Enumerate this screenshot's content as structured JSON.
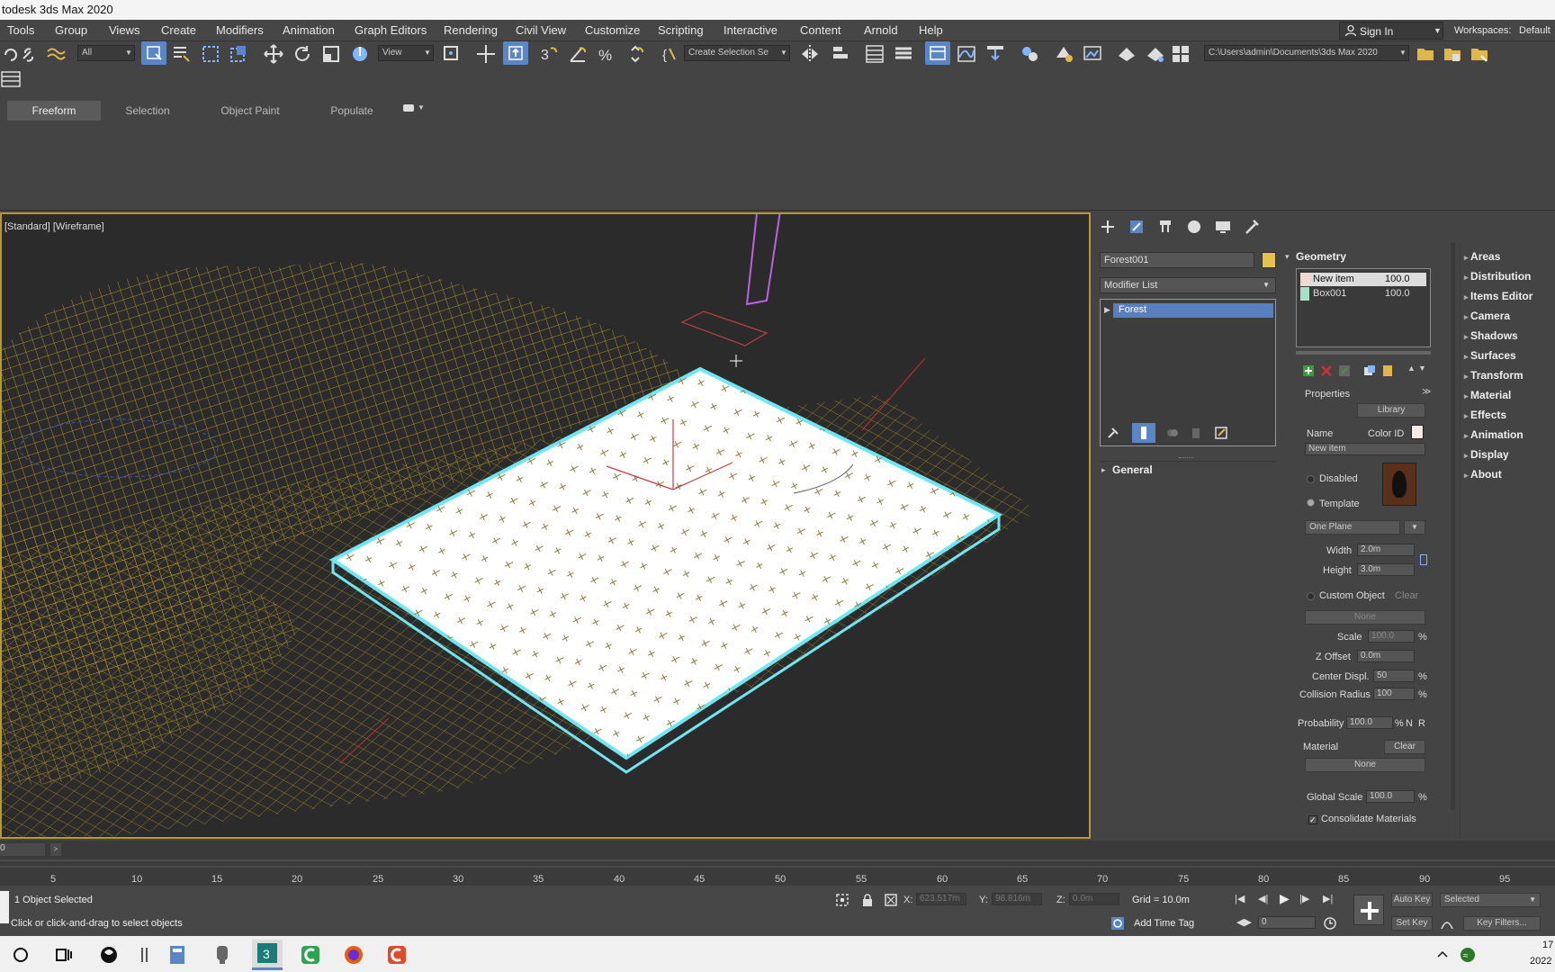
{
  "window": {
    "title": "todesk 3ds Max 2020"
  },
  "menu": {
    "items": [
      "Tools",
      "Group",
      "Views",
      "Create",
      "Modifiers",
      "Animation",
      "Graph Editors",
      "Rendering",
      "Civil View",
      "Customize",
      "Scripting",
      "Interactive",
      "Content",
      "Arnold",
      "Help"
    ],
    "sign_in": "Sign In",
    "workspaces_label": "Workspaces:",
    "workspaces_value": "Default"
  },
  "toolbar": {
    "filter_value": "All",
    "ref_coord_value": "View",
    "selection_set_value": "Create Selection Se",
    "project_path": "C:\\Users\\admin\\Documents\\3ds Max 2020"
  },
  "ribbon": {
    "tabs": [
      "Freeform",
      "Selection",
      "Object Paint",
      "Populate"
    ],
    "active_tab": "Freeform"
  },
  "viewport": {
    "label": "[Standard] [Wireframe]"
  },
  "command_panel": {
    "object_name": "Forest001",
    "object_color": "#e6c24d",
    "modifier_list": "Modifier List",
    "stack": [
      "Forest"
    ],
    "general_title": "General"
  },
  "geometry": {
    "title": "Geometry",
    "items": [
      {
        "name": "New item",
        "value": "100.0",
        "swatch": "#f2d9cf"
      },
      {
        "name": "Box001",
        "value": "100.0",
        "swatch": "#a6e0c8"
      }
    ],
    "properties_title": "Properties",
    "library_button": "Library",
    "name_label": "Name",
    "color_id_label": "Color ID",
    "name_value": "New item",
    "disabled_label": "Disabled",
    "template_label": "Template",
    "plane_value": "One Plane",
    "width_label": "Width",
    "width_value": "2.0m",
    "height_label": "Height",
    "height_value": "3.0m",
    "custom_object_label": "Custom Object",
    "clear_label": "Clear",
    "none_label": "None",
    "scale_label": "Scale",
    "scale_value": "100.0",
    "percent": "%",
    "z_offset_label": "Z Offset",
    "z_offset_value": "0.0m",
    "center_displ_label": "Center Displ.",
    "center_displ_value": "50",
    "collision_radius_label": "Collision Radius",
    "collision_radius_value": "100",
    "probability_label": "Probability",
    "probability_value": "100.0",
    "n_label": "N",
    "r_label": "R",
    "material_label": "Material",
    "material_clear": "Clear",
    "material_none": "None",
    "global_scale_label": "Global Scale",
    "global_scale_value": "100.0",
    "consolidate_label": "Consolidate Materials"
  },
  "rollouts": [
    "Areas",
    "Distribution",
    "Items Editor",
    "Camera",
    "Shadows",
    "Surfaces",
    "Transform",
    "Material",
    "Effects",
    "Animation",
    "Display",
    "About"
  ],
  "timeline": {
    "frame_field": "0",
    "ticks": [
      "5",
      "10",
      "15",
      "20",
      "25",
      "30",
      "35",
      "40",
      "45",
      "50",
      "55",
      "60",
      "65",
      "70",
      "75",
      "80",
      "85",
      "90",
      "95"
    ]
  },
  "status": {
    "selected_text": "1 Object Selected",
    "prompt_text": "Click or click-and-drag to select objects",
    "x_label": "X:",
    "x_value": "623.517m",
    "y_label": "Y:",
    "y_value": "98.816m",
    "z_label": "Z:",
    "z_value": "0.0m",
    "grid_text": "Grid = 10.0m",
    "add_time_tag": "Add Time Tag",
    "auto_key": "Auto Key",
    "selected_dropdown": "Selected",
    "set_key": "Set Key",
    "key_filters": "Key Filters...",
    "current_frame": "0"
  },
  "taskbar": {
    "time": "17",
    "date": "2022"
  }
}
